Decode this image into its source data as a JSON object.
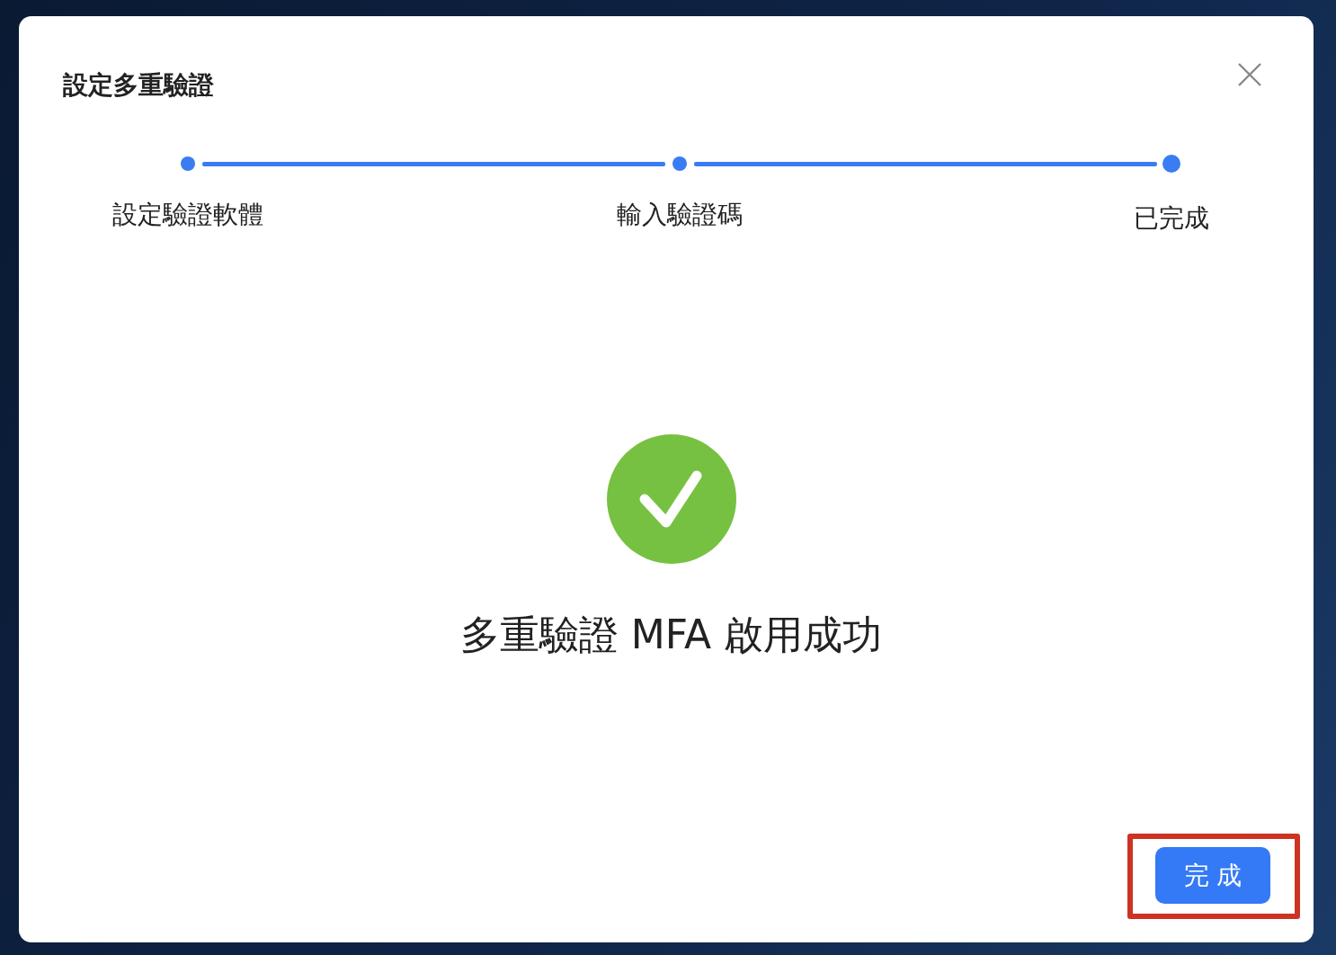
{
  "dialog": {
    "title": "設定多重驗證"
  },
  "steps": [
    {
      "label": "設定驗證軟體",
      "done": true,
      "selected": false
    },
    {
      "label": "輸入驗證碼",
      "done": true,
      "selected": false
    },
    {
      "label": "已完成",
      "done": true,
      "selected": true
    }
  ],
  "result": {
    "message": "多重驗證 MFA 啟用成功"
  },
  "done_button": {
    "label": "完 成",
    "highlighted": true
  }
}
